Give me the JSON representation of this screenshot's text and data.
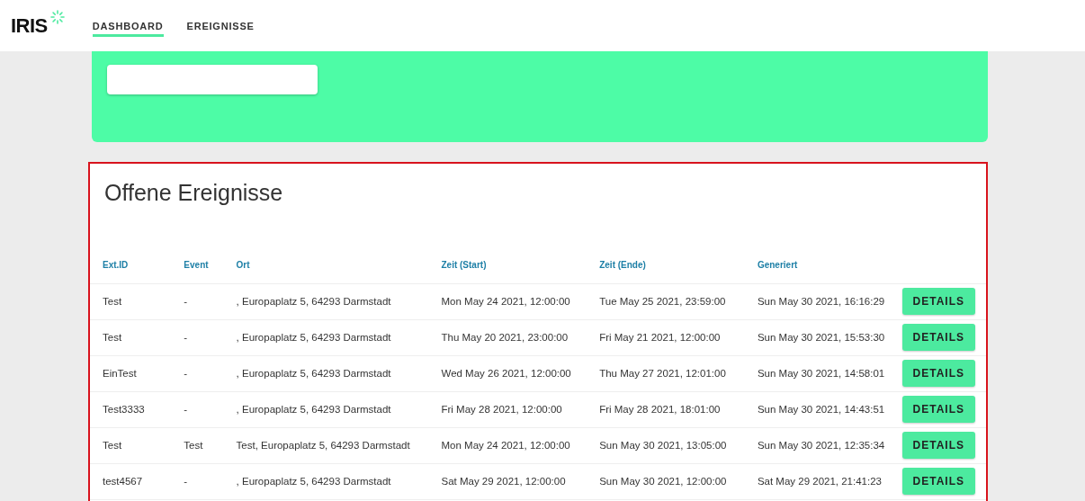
{
  "logo": "IRIS",
  "tabs": [
    {
      "label": "DASHBOARD",
      "selected": true
    },
    {
      "label": "EREIGNISSE",
      "selected": false
    }
  ],
  "events": {
    "title": "Offene Ereignisse",
    "columns": [
      "Ext.ID",
      "Event",
      "Ort",
      "Zeit (Start)",
      "Zeit (Ende)",
      "Generiert"
    ],
    "rows": [
      {
        "cells": [
          "Test",
          "-",
          ", Europaplatz 5, 64293 Darmstadt",
          "Mon May 24 2021, 12:00:00",
          "Tue May 25 2021, 23:59:00",
          "Sun May 30 2021, 16:16:29"
        ],
        "action": "DETAILS"
      },
      {
        "cells": [
          "Test",
          "-",
          ", Europaplatz 5, 64293 Darmstadt",
          "Thu May 20 2021, 23:00:00",
          "Fri May 21 2021, 12:00:00",
          "Sun May 30 2021, 15:53:30"
        ],
        "action": "DETAILS"
      },
      {
        "cells": [
          "EinTest",
          "-",
          ", Europaplatz 5, 64293 Darmstadt",
          "Wed May 26 2021, 12:00:00",
          "Thu May 27 2021, 12:01:00",
          "Sun May 30 2021, 14:58:01"
        ],
        "action": "DETAILS"
      },
      {
        "cells": [
          "Test3333",
          "-",
          ", Europaplatz 5, 64293 Darmstadt",
          "Fri May 28 2021, 12:00:00",
          "Fri May 28 2021, 18:01:00",
          "Sun May 30 2021, 14:43:51"
        ],
        "action": "DETAILS"
      },
      {
        "cells": [
          "Test",
          "Test",
          "Test, Europaplatz 5, 64293 Darmstadt",
          "Mon May 24 2021, 12:00:00",
          "Sun May 30 2021, 13:05:00",
          "Sun May 30 2021, 12:35:34"
        ],
        "action": "DETAILS"
      },
      {
        "cells": [
          "test4567",
          "-",
          ", Europaplatz 5, 64293 Darmstadt",
          "Sat May 29 2021, 12:00:00",
          "Sun May 30 2021, 12:00:00",
          "Sat May 29 2021, 21:41:23"
        ],
        "action": "DETAILS"
      }
    ]
  }
}
